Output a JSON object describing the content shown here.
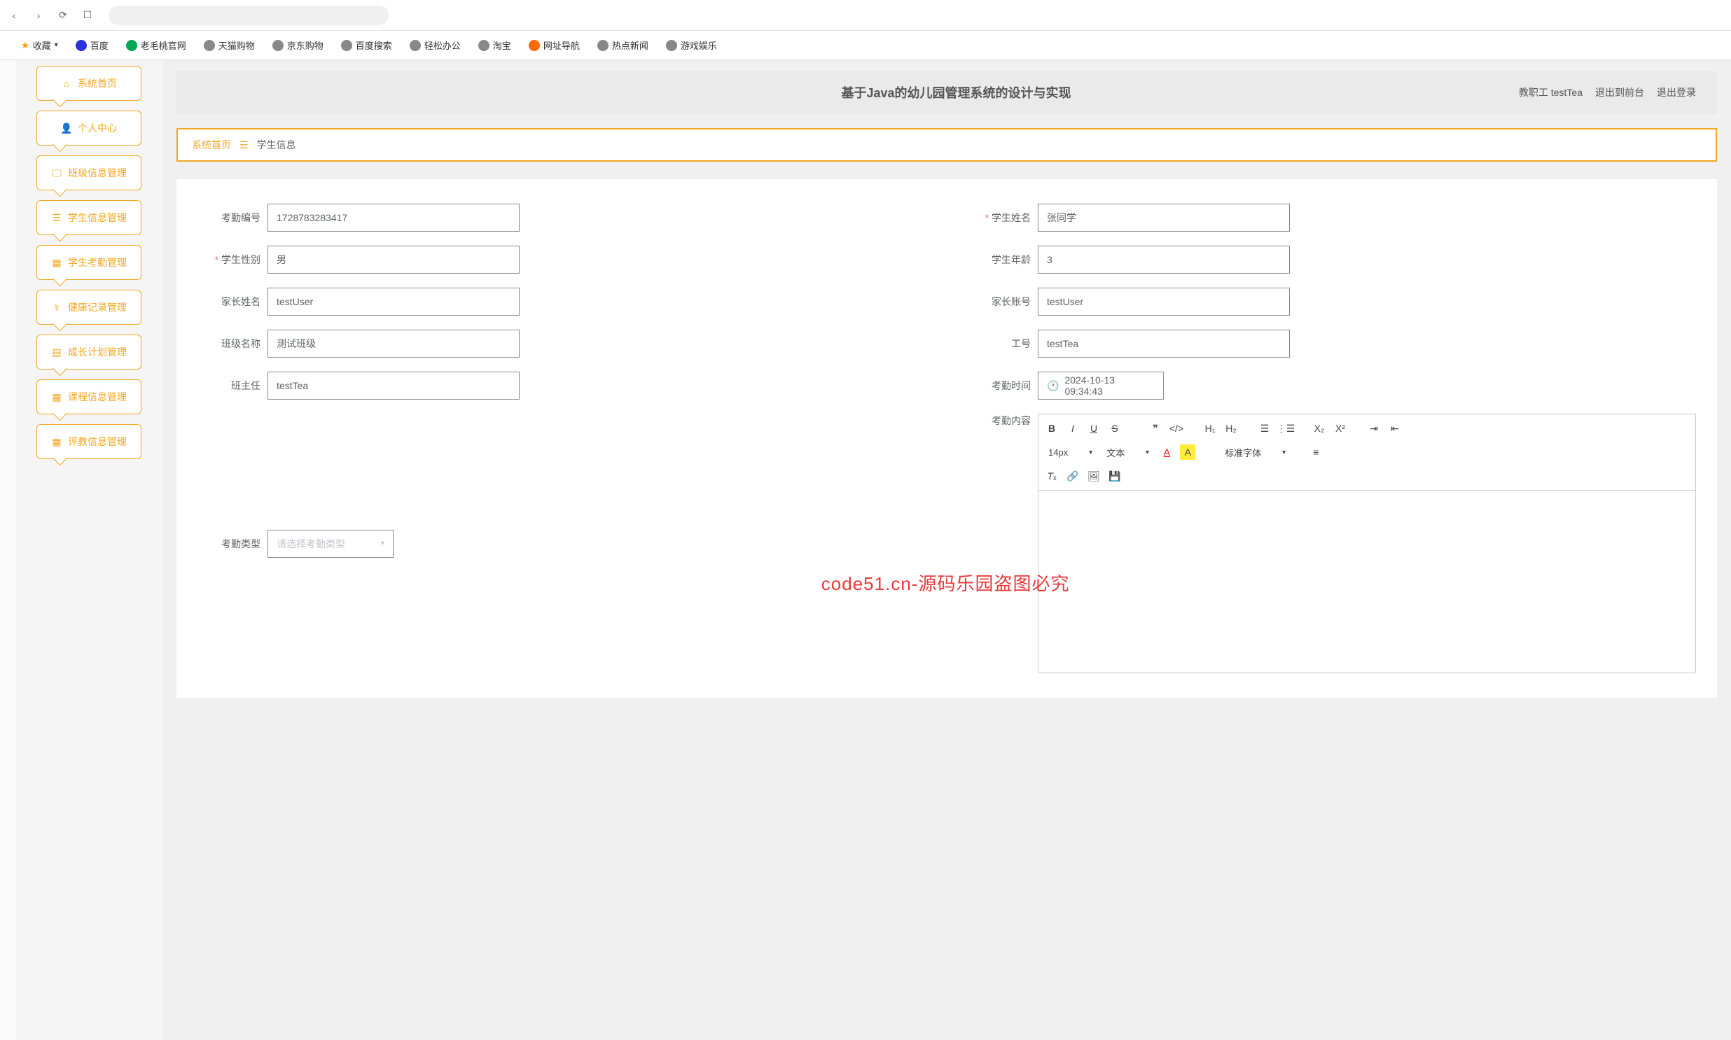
{
  "bookmarks": {
    "fav": "收藏",
    "items": [
      "百度",
      "老毛桃官网",
      "天猫购物",
      "京东购物",
      "百度搜索",
      "轻松办公",
      "淘宝",
      "网址导航",
      "热点新闻",
      "游戏娱乐"
    ]
  },
  "app": {
    "title": "基于Java的幼儿园管理系统的设计与实现"
  },
  "header": {
    "role": "教职工",
    "user": "testTea",
    "exit_front": "退出到前台",
    "logout": "退出登录"
  },
  "sidebar": {
    "items": [
      {
        "label": "系统首页",
        "icon": "home"
      },
      {
        "label": "个人中心",
        "icon": "user"
      },
      {
        "label": "班级信息管理",
        "icon": "screen"
      },
      {
        "label": "学生信息管理",
        "icon": "list"
      },
      {
        "label": "学生考勤管理",
        "icon": "grid"
      },
      {
        "label": "健康记录管理",
        "icon": "health"
      },
      {
        "label": "成长计划管理",
        "icon": "file"
      },
      {
        "label": "课程信息管理",
        "icon": "grid"
      },
      {
        "label": "评教信息管理",
        "icon": "grid"
      }
    ]
  },
  "breadcrumb": {
    "home": "系统首页",
    "page": "学生信息"
  },
  "form": {
    "attendance_no": {
      "label": "考勤编号",
      "value": "1728783283417"
    },
    "student_name": {
      "label": "学生姓名",
      "value": "张同学"
    },
    "student_gender": {
      "label": "学生性别",
      "value": "男"
    },
    "student_age": {
      "label": "学生年龄",
      "value": "3"
    },
    "parent_name": {
      "label": "家长姓名",
      "value": "testUser"
    },
    "parent_account": {
      "label": "家长账号",
      "value": "testUser"
    },
    "class_name": {
      "label": "班级名称",
      "value": "测试班级"
    },
    "work_no": {
      "label": "工号",
      "value": "testTea"
    },
    "head_teacher": {
      "label": "班主任",
      "value": "testTea"
    },
    "attendance_time": {
      "label": "考勤时间",
      "value": "2024-10-13 09:34:43"
    },
    "attendance_type": {
      "label": "考勤类型",
      "placeholder": "请选择考勤类型"
    },
    "attendance_content": {
      "label": "考勤内容"
    }
  },
  "editor": {
    "font_size": "14px",
    "text_style": "文本",
    "font_family": "标准字体"
  },
  "watermark": "code51.cn-源码乐园盗图必究"
}
